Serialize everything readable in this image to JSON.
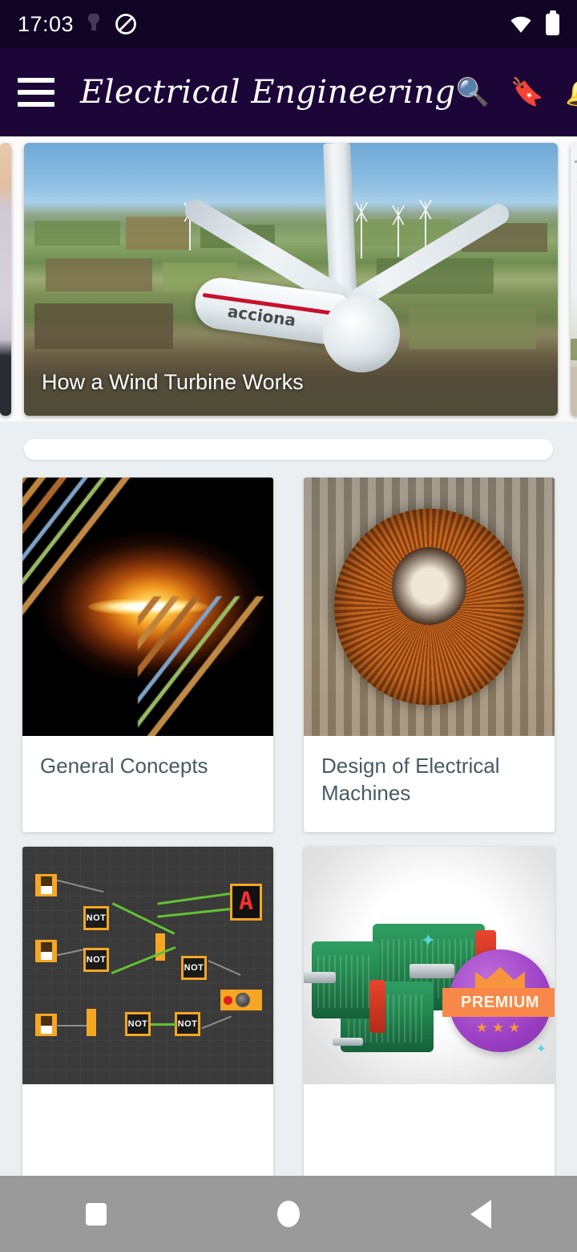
{
  "status_bar": {
    "time": "17:03",
    "icons": [
      "dnd-icon",
      "wifi-icon",
      "battery-icon"
    ]
  },
  "app_bar": {
    "menu_icon": "hamburger-menu-icon",
    "title": "Electrical Engineering",
    "actions": [
      {
        "name": "search-icon",
        "glyph": "🔍"
      },
      {
        "name": "bookmark-icon",
        "glyph": "🔖"
      },
      {
        "name": "notifications-icon",
        "glyph": "🔔"
      }
    ]
  },
  "carousel": {
    "slides": [
      {
        "caption": "",
        "art": "person"
      },
      {
        "caption": "How a Wind Turbine Works",
        "art": "wind-turbine",
        "brand": "acciona"
      },
      {
        "caption": "",
        "art": "power-lines"
      }
    ],
    "active_index": 1
  },
  "ad_slot": {
    "label": ""
  },
  "grid": {
    "cards": [
      {
        "title": "General Concepts",
        "art": "copper-cables-spark",
        "premium": false
      },
      {
        "title": "Design of Electrical Machines",
        "art": "motor-stator-windings",
        "premium": false
      },
      {
        "title": "",
        "art": "logic-gate-simulator",
        "premium": false
      },
      {
        "title": "",
        "art": "green-electric-motors",
        "premium": true,
        "badge": "PREMIUM"
      }
    ]
  },
  "logic_art": {
    "gate_label": "NOT",
    "display_char": "A"
  },
  "nav_bar": {
    "buttons": [
      {
        "name": "recents-button"
      },
      {
        "name": "home-button"
      },
      {
        "name": "back-button"
      }
    ]
  },
  "colors": {
    "app_bar": "#1c0638",
    "status_bar": "#120425",
    "page_bg": "#eceff1",
    "card_bg": "#ffffff",
    "card_title": "#455a64",
    "nav_bar": "#9a9a9a",
    "badge_purple": "#9b3fc4",
    "badge_orange": "#f7884a"
  }
}
